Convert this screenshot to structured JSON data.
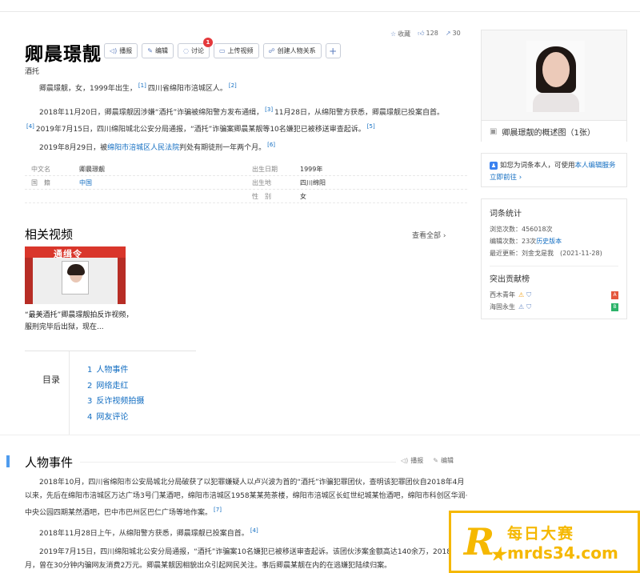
{
  "header": {
    "title": "卿晨璟靓",
    "subtitle": "酒托",
    "toolbar": {
      "broadcast": "播报",
      "edit": "编辑",
      "discuss": "讨论",
      "discuss_badge": "1",
      "upload_video": "上传视频",
      "create_relation": "创建人物关系",
      "add": "+"
    },
    "stats": {
      "favorite": "收藏",
      "likes": "128",
      "shares": "30"
    }
  },
  "summary": {
    "p1": "卿晨璟靓，女，1999年出生，",
    "p1_ref1": "[1]",
    "p1_mid": "四川省绵阳市涪城区人。",
    "p1_ref2": "[2]",
    "p2_a": "2018年11月20日，卿晨璟靓因涉嫌“酒托”诈骗被绵阳警方发布通缉，",
    "p2_ref1": "[3]",
    "p2_b": "11月28日，从绵阳警方获悉，卿晨璟靓已投案自首。",
    "p2_ref2": "[4]",
    "p2_c": "2019年7月15日，四川绵阳城北公安分局通报，“酒托”诈骗案卿晨某靓等10名嫌犯已被移送审查起诉。",
    "p2_ref3": "[5]",
    "p3_a": "2019年8月29日，被",
    "p3_link": "绵阳市涪城区人民法院",
    "p3_b": "判处有期徒刑一年两个月。",
    "p3_ref": "[6]"
  },
  "infobox": {
    "left": [
      {
        "key": "中文名",
        "value": "卿晨璟靓"
      },
      {
        "key": "国　籍",
        "value": "中国"
      }
    ],
    "right": [
      {
        "key": "出生日期",
        "value": "1999年"
      },
      {
        "key": "出生地",
        "value": "四川绵阳"
      },
      {
        "key": "性　别",
        "value": "女"
      }
    ]
  },
  "related_videos": {
    "heading": "相关视频",
    "view_all": "查看全部 ›",
    "thumb_logo": "通缉令",
    "caption": "“最美酒托”卿晨璟靓拍反诈视频，服刑完毕后出狱，现在..."
  },
  "toc": {
    "label": "目录",
    "items": [
      {
        "num": "1",
        "text": "人物事件"
      },
      {
        "num": "2",
        "text": "网络走红"
      },
      {
        "num": "3",
        "text": "反诈视频拍摄"
      },
      {
        "num": "4",
        "text": "网友评论"
      }
    ]
  },
  "section": {
    "heading": "人物事件",
    "broadcast": "播报",
    "edit": "编辑",
    "p1": "2018年10月，四川省绵阳市公安局城北分局破获了以犯罪嫌疑人以卢兴波为首的“酒托”诈骗犯罪团伙，查明该犯罪团伙自2018年4月以来，先后在绵阳市涪城区万达广场3号门某酒吧，绵阳市涪城区1958某某苑茶楼，绵阳市涪城区长虹世纪城某怡酒吧，绵阳市科创区华润·中央公园四期某然酒吧，巴中市巴州区巴仁广场等地作案。",
    "p1_ref": "[7]",
    "p2": "2018年11月28日上午，从绵阳警方获悉，卿晨璟靓已投案自首。",
    "p2_ref": "[4]",
    "p3": "2019年7月15日，四川绵阳城北公安分局通报，“酒托”诈骗案10名嫌犯已被移送审查起诉。该团伙涉案金额高达140余万，2018年10月，曾在30分钟内骗网友消费2万元。卿晨某靓因相貌出众引起网民关注。事后卿晨某靓在内的在逃嫌犯陆续归案。"
  },
  "sidebar": {
    "album_caption": "卿晨璟靓的概述图（1张）",
    "claim_text": "如您为词条本人，可使用",
    "claim_link": "本人编辑服务",
    "claim_go": "立即前往 ›",
    "stats_heading": "词条统计",
    "views": "浏览次数：456018次",
    "edits_prefix": "编辑次数：23次",
    "edits_link": "历史版本",
    "last_update": "最近更新：刘金戈是我　(2021-11-28)",
    "contrib_heading": "突出贡献榜",
    "contributors": [
      {
        "name": "西木青年",
        "tag": "A",
        "tag_color": "#e4573c"
      },
      {
        "name": "海固永生",
        "tag": "B",
        "tag_color": "#2db36a"
      }
    ]
  },
  "watermark": {
    "letter": "R",
    "line1": "每日大赛",
    "line2": "mrds34.com",
    "color": "#f5b800"
  }
}
